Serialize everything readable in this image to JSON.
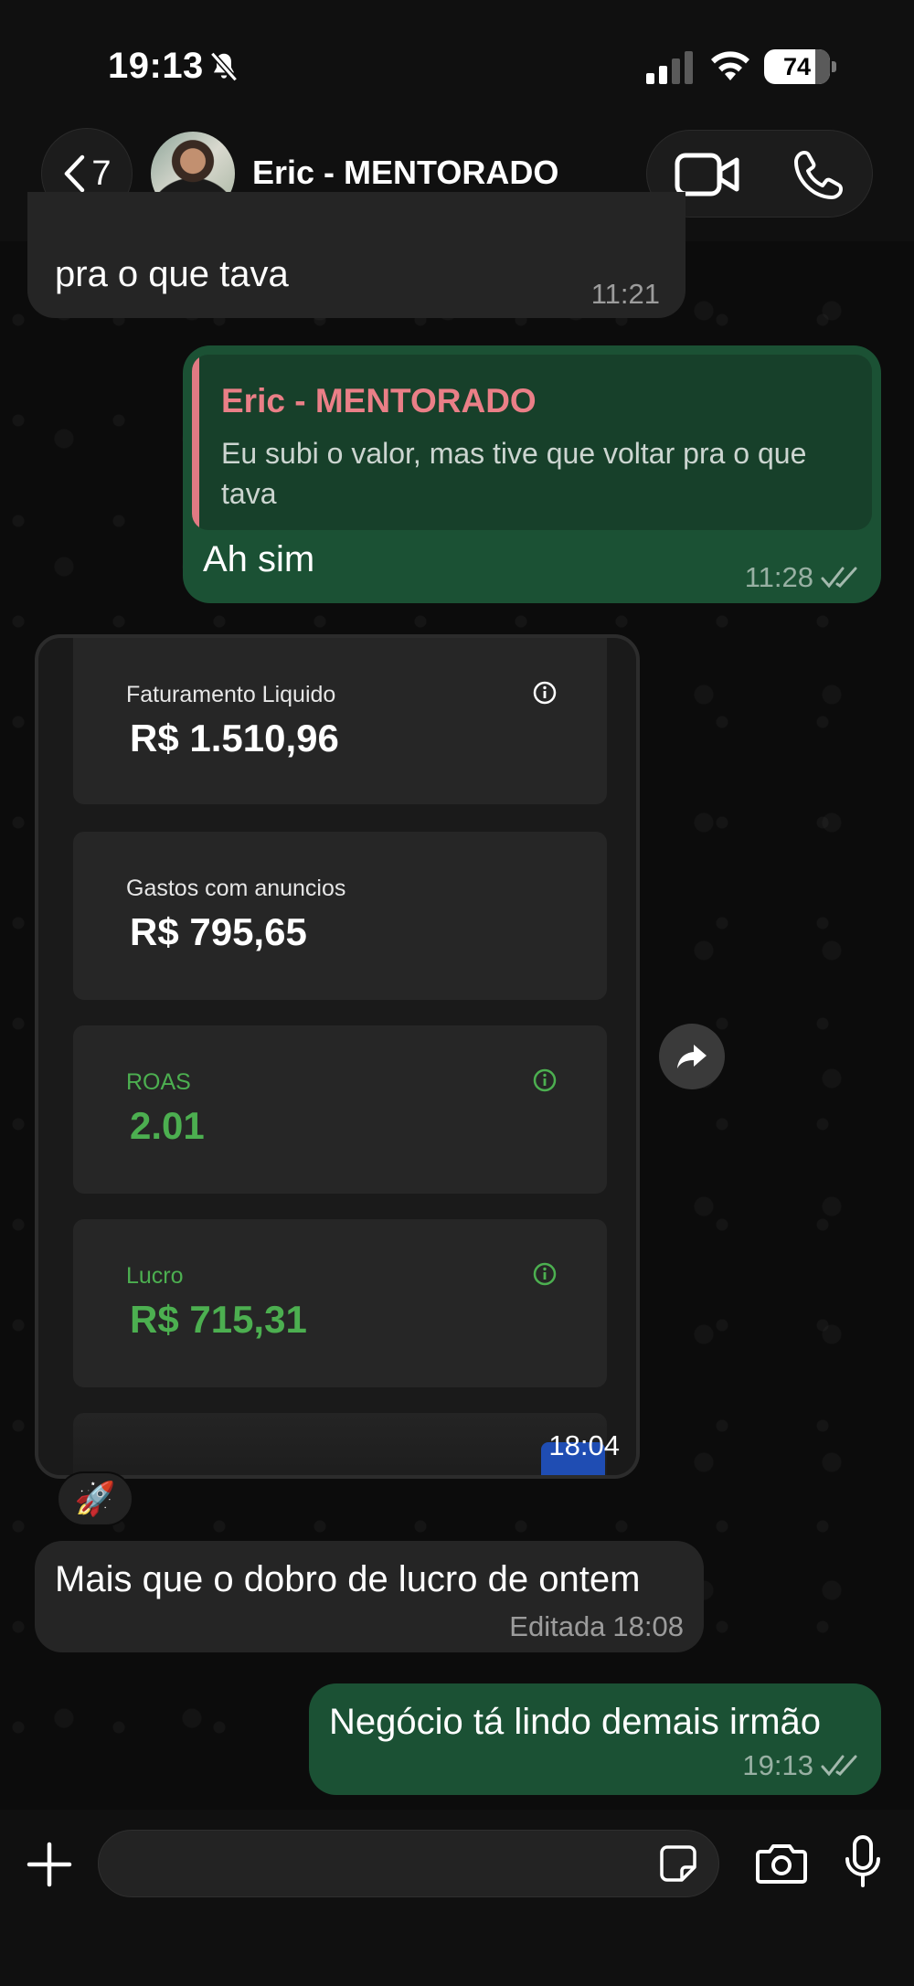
{
  "status_bar": {
    "time": "19:13",
    "battery": "74"
  },
  "header": {
    "back_count": "7",
    "contact_name": "Eric - MENTORADO"
  },
  "messages": {
    "m1": {
      "text": "pra o que tava",
      "time": "11:21"
    },
    "m2": {
      "quote_author": "Eric - MENTORADO",
      "quote_text": "Eu subi o valor, mas tive que voltar pra o que tava",
      "text": "Ah sim",
      "time": "11:28"
    },
    "image": {
      "time": "18:04",
      "cards": [
        {
          "label": "Faturamento Liquido",
          "value": "R$ 1.510,96"
        },
        {
          "label": "Gastos com anuncios",
          "value": "R$ 795,65"
        },
        {
          "label": "ROAS",
          "value": "2.01"
        },
        {
          "label": "Lucro",
          "value": "R$ 715,31"
        }
      ]
    },
    "reaction": "🚀",
    "m3": {
      "text": "Mais que o dobro de lucro de ontem",
      "edited": "Editada",
      "time": "18:08"
    },
    "m4": {
      "text": "Negócio tá lindo demais irmão",
      "time": "19:13"
    }
  },
  "colors": {
    "outgoing_bubble": "#1b5134",
    "incoming_bubble": "#252525",
    "quote_author": "#ea7f87",
    "profit_green": "#4caf50"
  }
}
